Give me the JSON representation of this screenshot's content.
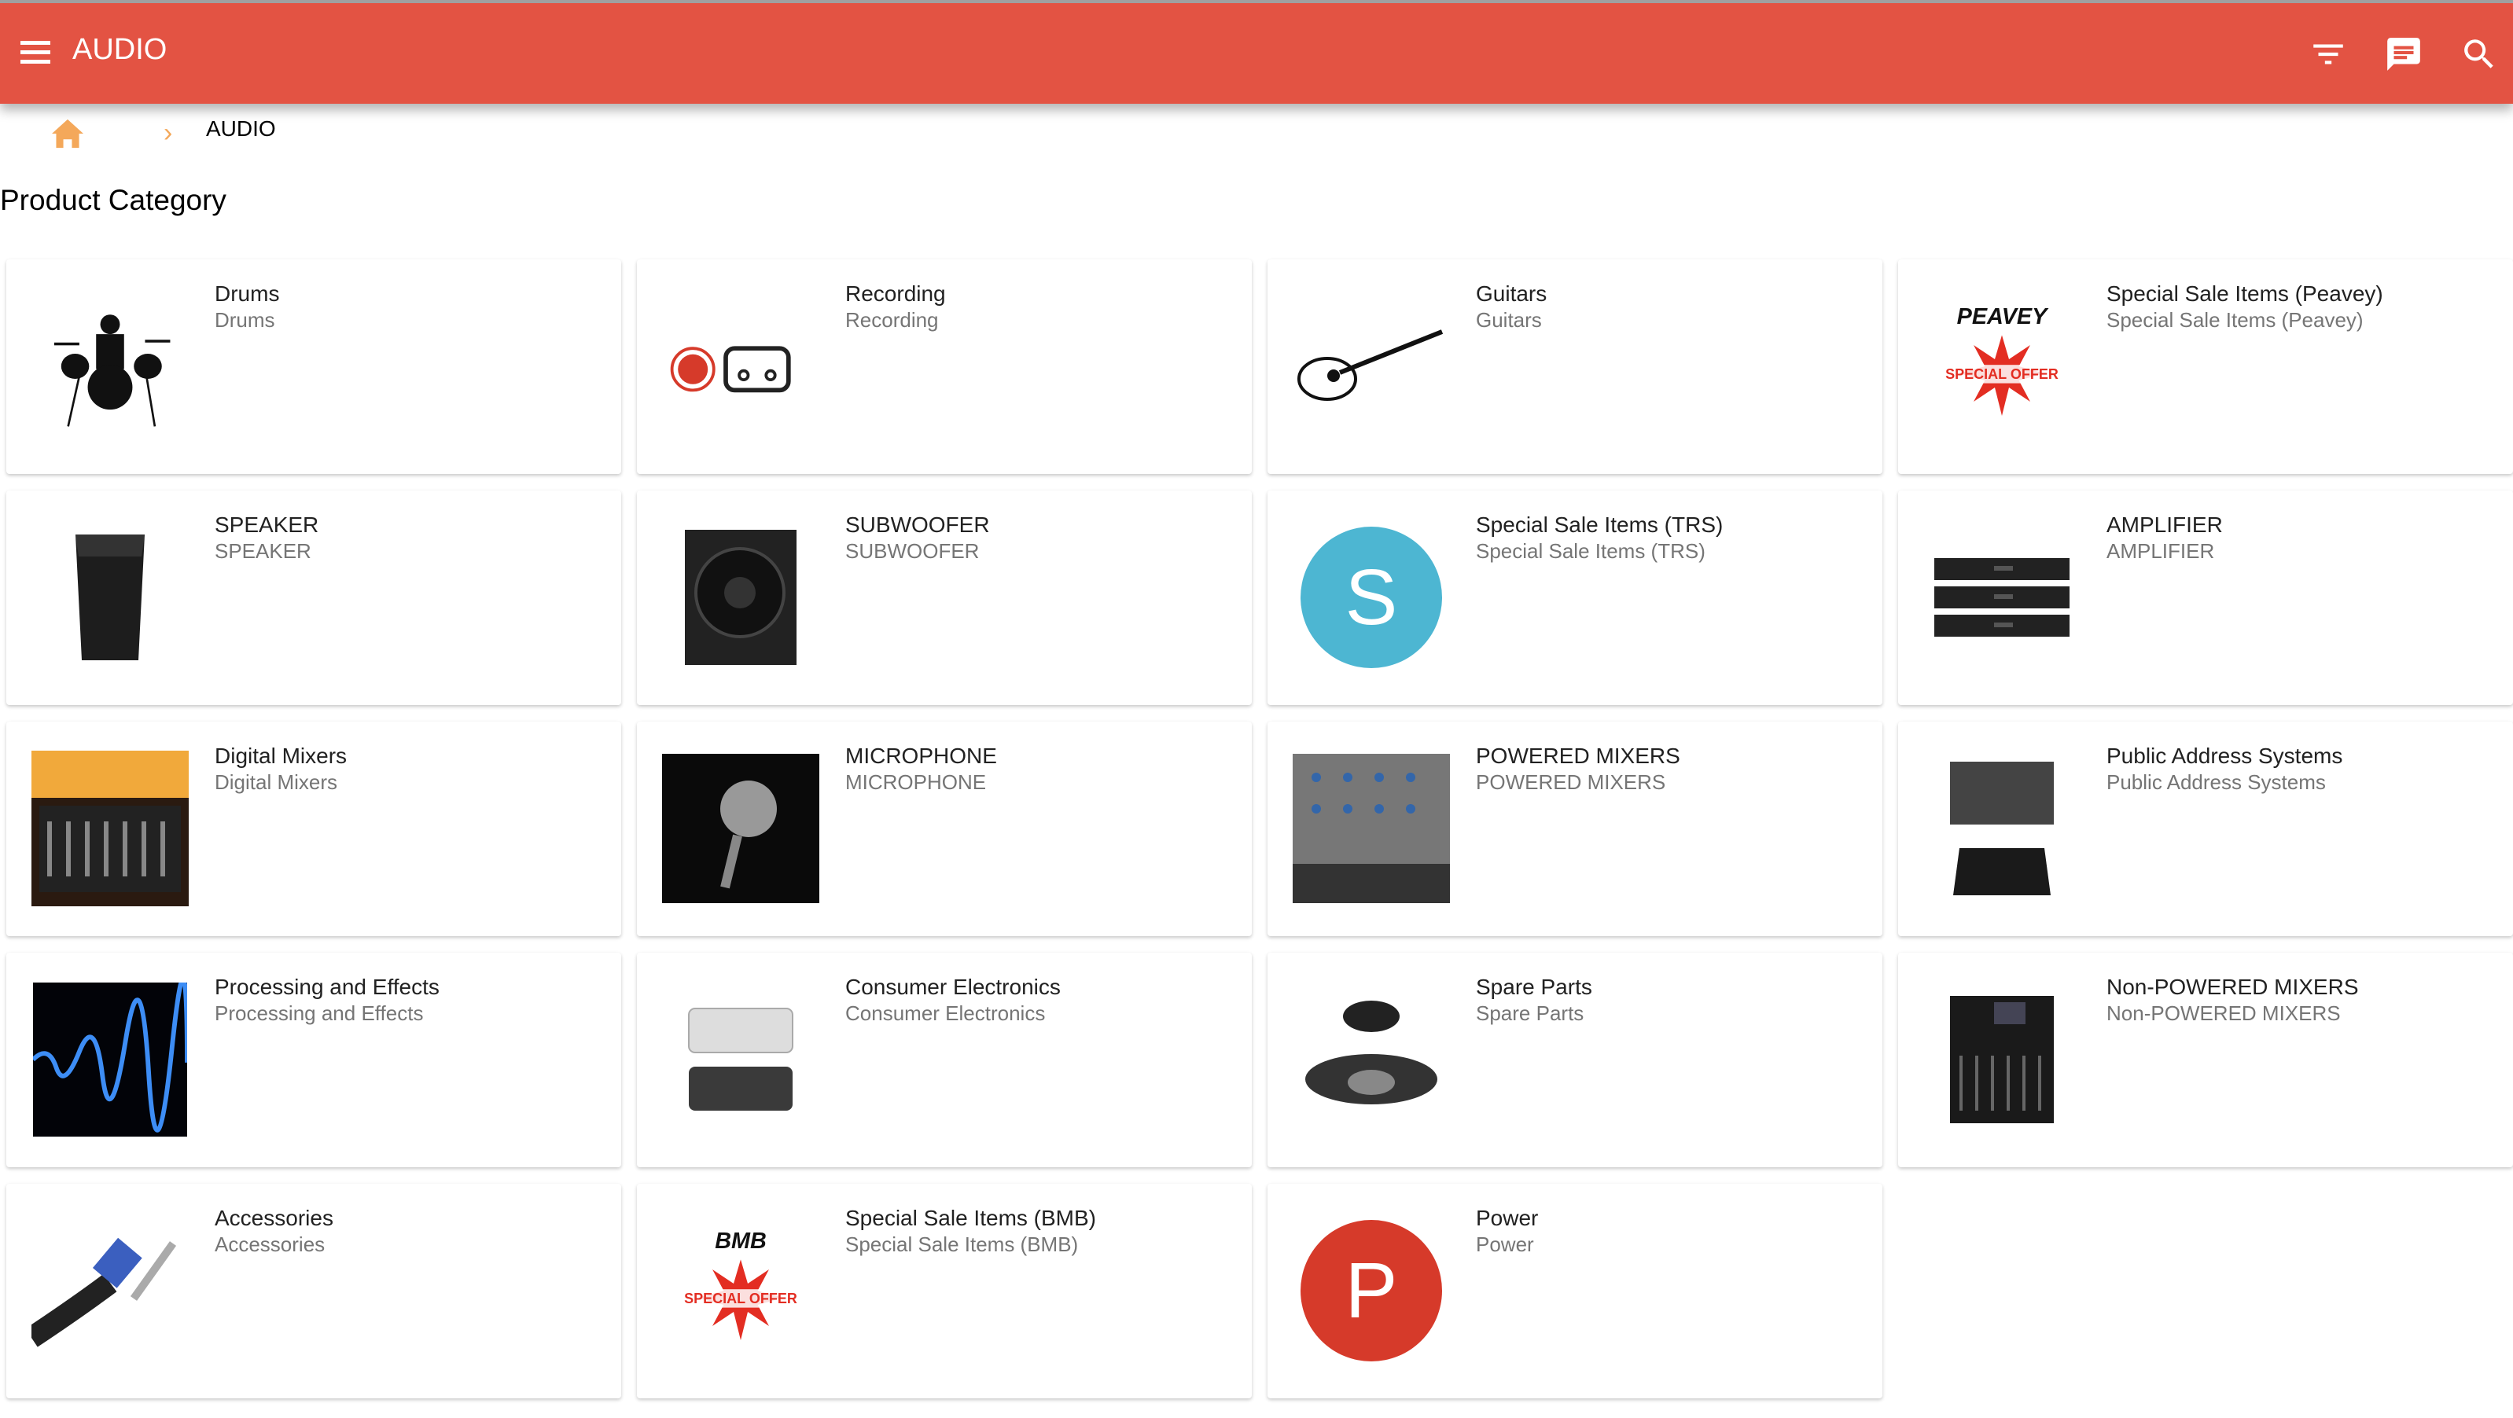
{
  "app": {
    "title": "AUDIO",
    "icons": [
      "menu-icon",
      "filter-icon",
      "message-icon",
      "search-icon"
    ],
    "accent": "#e35343"
  },
  "breadcrumb": {
    "home_icon": "home-icon",
    "current": "AUDIO"
  },
  "page": {
    "heading": "Product Category"
  },
  "categories": [
    {
      "title": "Drums",
      "subtitle": "Drums",
      "thumb": "drums"
    },
    {
      "title": "Recording",
      "subtitle": "Recording",
      "thumb": "recording"
    },
    {
      "title": "Guitars",
      "subtitle": "Guitars",
      "thumb": "guitar"
    },
    {
      "title": "Special Sale Items (Peavey)",
      "subtitle": "Special Sale Items (Peavey)",
      "thumb": "offer",
      "brand": "PEAVEY",
      "badge": "SPECIAL OFFER"
    },
    {
      "title": "SPEAKER",
      "subtitle": "SPEAKER",
      "thumb": "speaker"
    },
    {
      "title": "SUBWOOFER",
      "subtitle": "SUBWOOFER",
      "thumb": "subwoofer"
    },
    {
      "title": "Special Sale Items (TRS)",
      "subtitle": "Special Sale Items (TRS)",
      "thumb": "letter",
      "letter": "S",
      "color": "#4db6d2"
    },
    {
      "title": "AMPLIFIER",
      "subtitle": "AMPLIFIER",
      "thumb": "amplifier"
    },
    {
      "title": "Digital Mixers",
      "subtitle": "Digital Mixers",
      "thumb": "photo"
    },
    {
      "title": "MICROPHONE",
      "subtitle": "MICROPHONE",
      "thumb": "microphone"
    },
    {
      "title": "POWERED MIXERS",
      "subtitle": "POWERED MIXERS",
      "thumb": "mixer"
    },
    {
      "title": "Public Address Systems",
      "subtitle": "Public Address Systems",
      "thumb": "pa"
    },
    {
      "title": "Processing and Effects",
      "subtitle": "Processing and Effects",
      "thumb": "wave"
    },
    {
      "title": "Consumer Electronics",
      "subtitle": "Consumer Electronics",
      "thumb": "consumer"
    },
    {
      "title": "Spare Parts",
      "subtitle": "Spare Parts",
      "thumb": "driver"
    },
    {
      "title": "Non-POWERED MIXERS",
      "subtitle": "Non-POWERED MIXERS",
      "thumb": "smallmixer"
    },
    {
      "title": "Accessories",
      "subtitle": "Accessories",
      "thumb": "cable"
    },
    {
      "title": "Special Sale Items (BMB)",
      "subtitle": "Special Sale Items (BMB)",
      "thumb": "offer",
      "brand": "BMB",
      "badge": "SPECIAL OFFER"
    },
    {
      "title": "Power",
      "subtitle": "Power",
      "thumb": "letter",
      "letter": "P",
      "color": "#d63a2a"
    }
  ]
}
